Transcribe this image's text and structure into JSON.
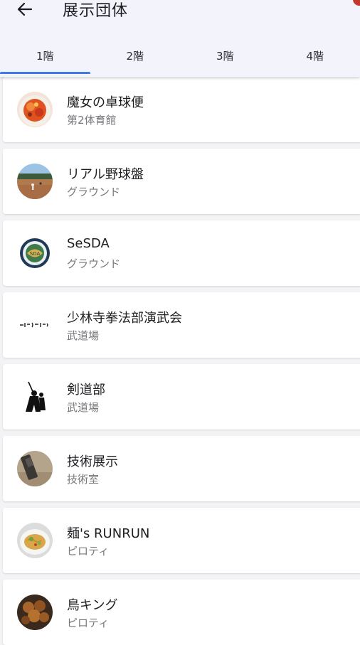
{
  "header": {
    "back_icon": "arrow-left-icon",
    "title": "展示団体"
  },
  "tabs": [
    {
      "label": "1階",
      "selected": true
    },
    {
      "label": "2階",
      "selected": false
    },
    {
      "label": "3階",
      "selected": false
    },
    {
      "label": "4階",
      "selected": false
    }
  ],
  "colors": {
    "accent": "#3f7be0",
    "appbar_bg": "#f2f3fb",
    "card_bg": "#ffffff",
    "page_bg": "#f3f3f6"
  },
  "groups": [
    {
      "name": "魔女の卓球便",
      "place": "第2体育館",
      "image": "food-photo"
    },
    {
      "name": "リアル野球盤",
      "place": "グラウンド",
      "image": "baseball-field-photo"
    },
    {
      "name": "SeSDA",
      "place": "グラウンド",
      "image": "sesda-logo"
    },
    {
      "name": "少林寺拳法部演武会",
      "place": "武道場",
      "image": "shorinji-logo"
    },
    {
      "name": "剣道部",
      "place": "武道場",
      "image": "kendo-silhouette"
    },
    {
      "name": "技術展示",
      "place": "技術室",
      "image": "tech-device-photo"
    },
    {
      "name": "麺's RUNRUN",
      "place": "ピロティ",
      "image": "noodle-photo"
    },
    {
      "name": "鳥キング",
      "place": "ピロティ",
      "image": "fried-chicken-photo"
    }
  ]
}
